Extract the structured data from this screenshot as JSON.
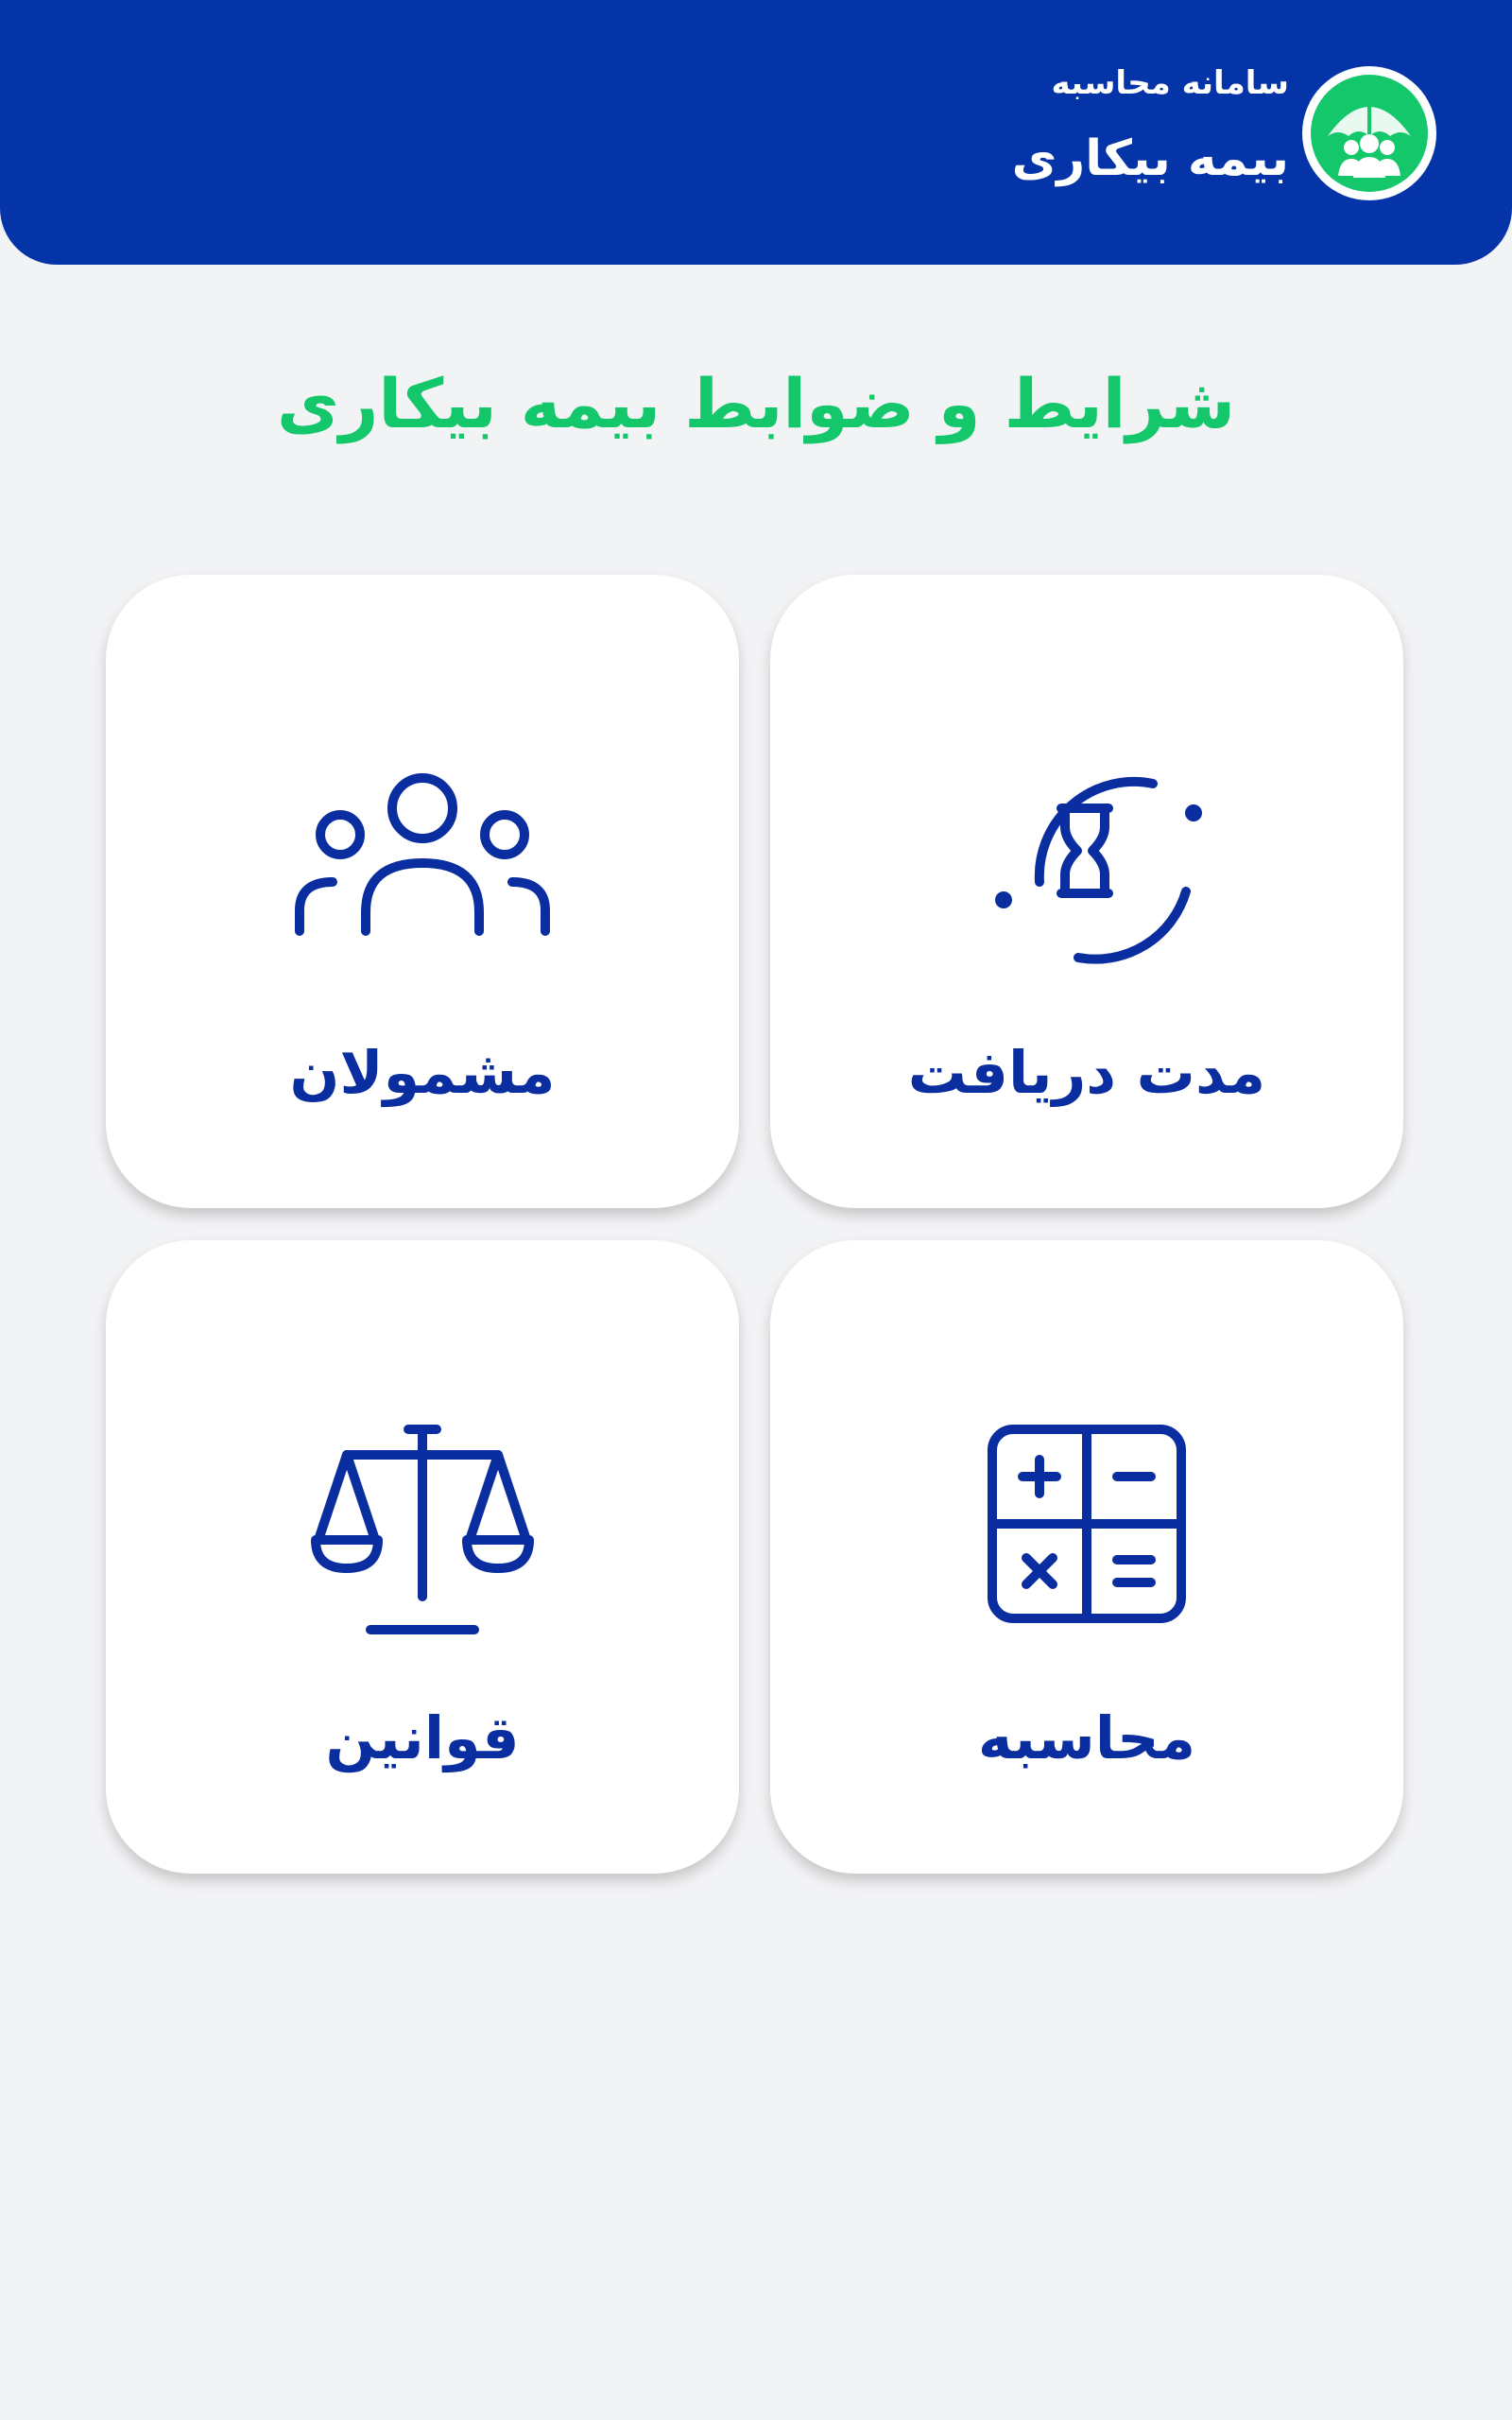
{
  "header": {
    "subtitle": "سامانه محاسبه",
    "title": "بیمه بیکاری",
    "logo_icon": "umbrella-people-icon"
  },
  "page_title": "شرایط و ضوابط بیمه بیکاری",
  "colors": {
    "header_bg": "#0534a8",
    "accent_green": "#15c76b",
    "icon_blue": "#0a2ea0",
    "page_bg": "#f2f3f5",
    "card_bg": "#ffffff"
  },
  "cards": {
    "duration": {
      "label": "مدت دریافت",
      "icon": "hourglass-timer-icon"
    },
    "covered": {
      "label": "مشمولان",
      "icon": "people-group-icon"
    },
    "calc": {
      "label": "محاسبه",
      "icon": "calculator-icon"
    },
    "laws": {
      "label": "قوانین",
      "icon": "scales-icon"
    }
  }
}
